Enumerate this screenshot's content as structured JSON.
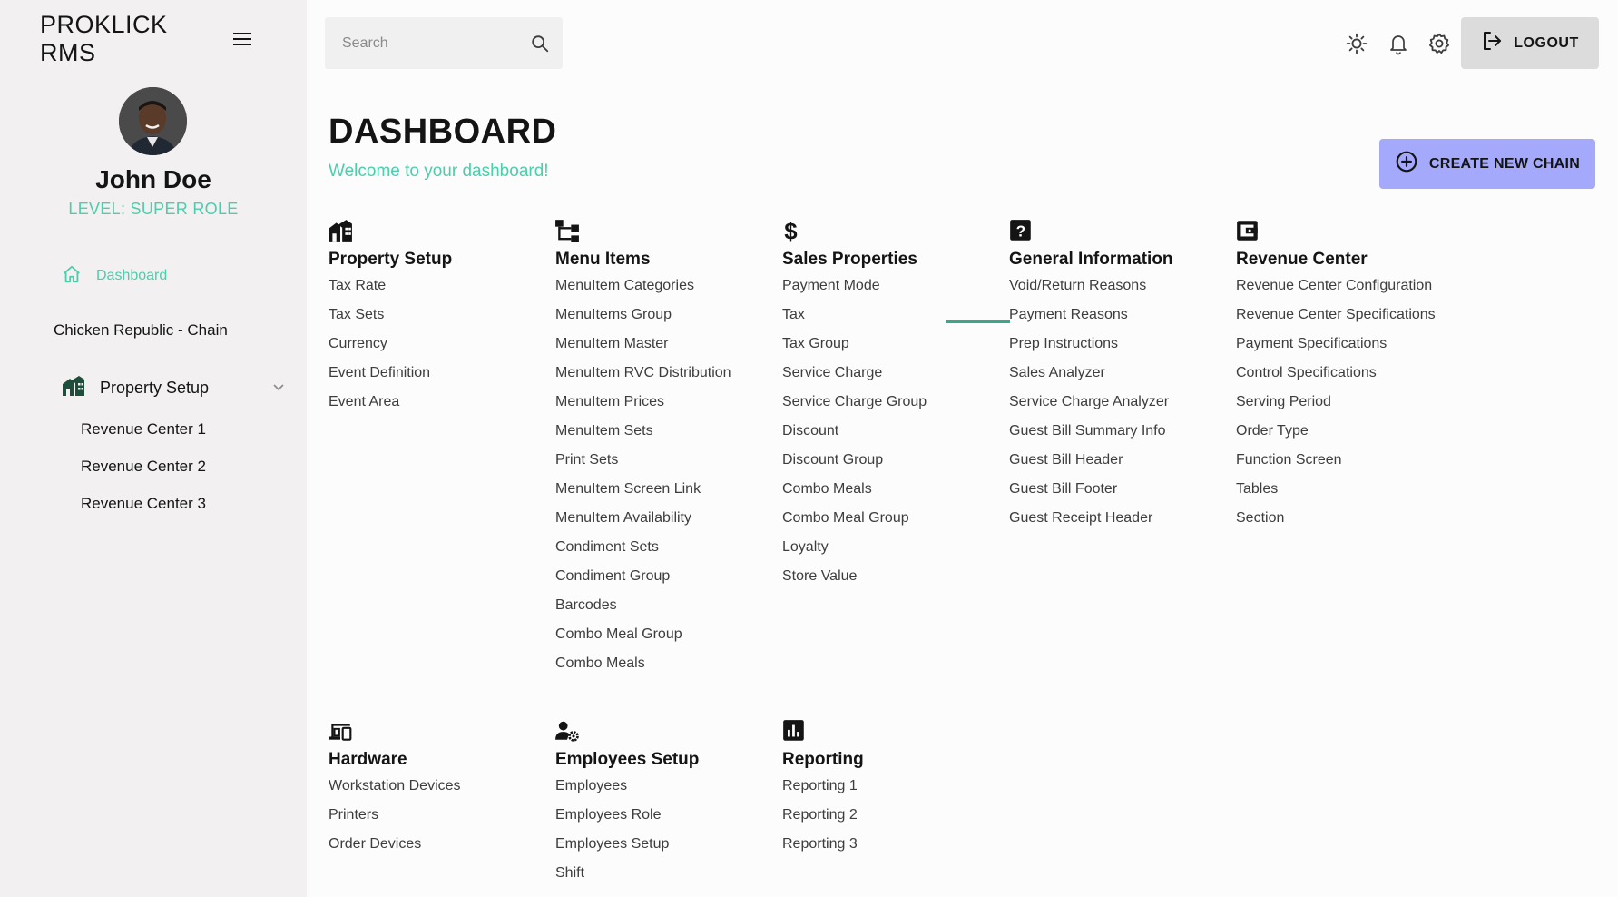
{
  "app": {
    "brand": "PROKLICK RMS"
  },
  "user": {
    "name": "John Doe",
    "level": "LEVEL: SUPER ROLE"
  },
  "sidebar": {
    "dashboard_label": "Dashboard",
    "chain_name": "Chicken Republic - Chain",
    "property_label": "Property Setup",
    "revenue_centers": [
      "Revenue Center 1",
      "Revenue Center 2",
      "Revenue Center 3"
    ]
  },
  "topbar": {
    "search_placeholder": "Search",
    "search_value": "",
    "logout_label": "LOGOUT"
  },
  "header": {
    "title": "DASHBOARD",
    "subtitle": "Welcome to your dashboard!",
    "create_label": "CREATE NEW CHAIN"
  },
  "sections": [
    {
      "title": "Property Setup",
      "icon": "building-icon",
      "items": [
        "Tax Rate",
        "Tax Sets",
        "Currency",
        "Event Definition",
        "Event Area"
      ]
    },
    {
      "title": "Menu Items",
      "icon": "hierarchy-icon",
      "items": [
        "MenuItem Categories",
        "MenuItems Group",
        "MenuItem Master",
        "MenuItem RVC Distribution",
        "MenuItem Prices",
        "MenuItem Sets",
        "Print Sets",
        "MenuItem Screen Link",
        "MenuItem Availability",
        "Condiment Sets",
        "Condiment Group",
        "Barcodes",
        "Combo Meal Group",
        "Combo Meals"
      ]
    },
    {
      "title": "Sales Properties",
      "icon": "dollar-icon",
      "items": [
        "Payment Mode",
        "Tax",
        "Tax Group",
        "Service Charge",
        "Service Charge Group",
        "Discount",
        "Discount Group",
        "Combo Meals",
        "Combo Meal Group",
        "Loyalty",
        "Store Value"
      ]
    },
    {
      "title": "General Information",
      "icon": "question-icon",
      "items": [
        "Void/Return Reasons",
        "Payment Reasons",
        "Prep Instructions",
        "Sales Analyzer",
        "Service Charge Analyzer",
        "Guest Bill Summary Info",
        "Guest Bill Header",
        "Guest Bill Footer",
        "Guest Receipt Header"
      ]
    },
    {
      "title": "Revenue Center",
      "icon": "wallet-icon",
      "items": [
        "Revenue Center Configuration",
        "Revenue Center Specifications",
        "Payment Specifications",
        "Control Specifications",
        "Serving Period",
        "Order Type",
        "Function Screen",
        "Tables",
        "Section"
      ]
    },
    {
      "title": "Hardware",
      "icon": "devices-icon",
      "items": [
        "Workstation Devices",
        "Printers",
        "Order Devices"
      ]
    },
    {
      "title": "Employees Setup",
      "icon": "user-gear-icon",
      "items": [
        "Employees",
        "Employees Role",
        "Employees Setup",
        "Shift"
      ]
    },
    {
      "title": "Reporting",
      "icon": "bar-chart-icon",
      "items": [
        "Reporting 1",
        "Reporting 2",
        "Reporting 3"
      ]
    }
  ],
  "colors": {
    "accent_green": "#4cceac",
    "create_button": "#a4a9fc",
    "sidebar_bg": "#f2f0f0",
    "logout_bg": "#dcdcdc"
  }
}
